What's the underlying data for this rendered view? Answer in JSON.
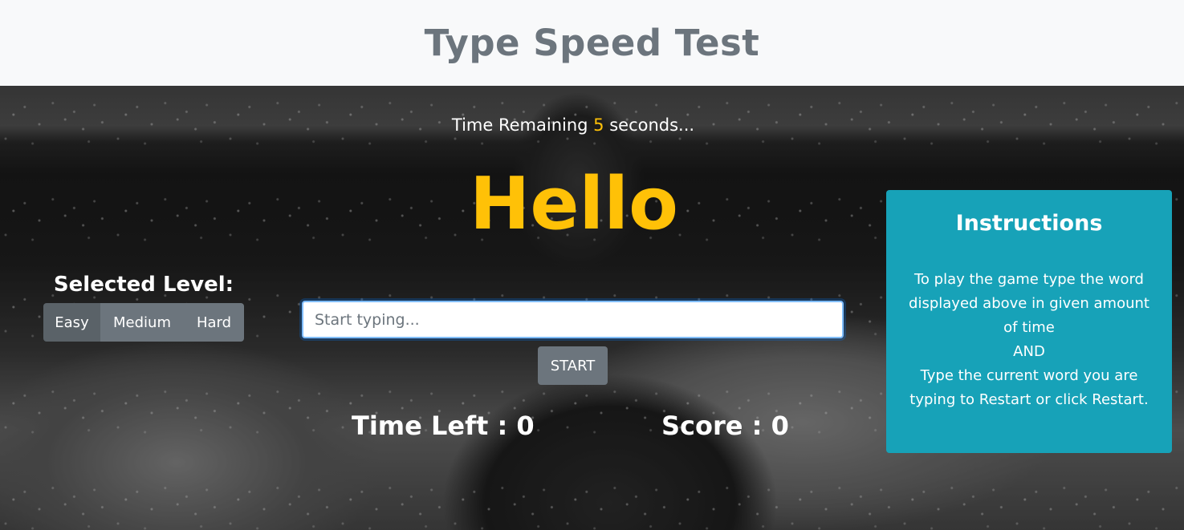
{
  "header": {
    "title": "Type Speed Test"
  },
  "game": {
    "time_remaining_prefix": "Time Remaining ",
    "time_remaining_value": "5",
    "time_remaining_suffix": " seconds...",
    "current_word": "Hello",
    "input_placeholder": "Start typing...",
    "input_value": "",
    "start_label": "START",
    "time_left_label": "Time Left : ",
    "time_left_value": "0",
    "score_label": "Score : ",
    "score_value": "0"
  },
  "level": {
    "heading": "Selected Level:",
    "options": [
      "Easy",
      "Medium",
      "Hard"
    ],
    "selected": "Easy"
  },
  "instructions": {
    "title": "Instructions",
    "line1": "To play the game type the word displayed above in given amount of time",
    "line2": "AND",
    "line3": "Type the current word you are typing to Restart or click Restart."
  },
  "colors": {
    "accent": "#ffc107",
    "info_panel": "#17a2b8",
    "secondary": "#6c757d",
    "header_bg": "#f8f9fa"
  }
}
